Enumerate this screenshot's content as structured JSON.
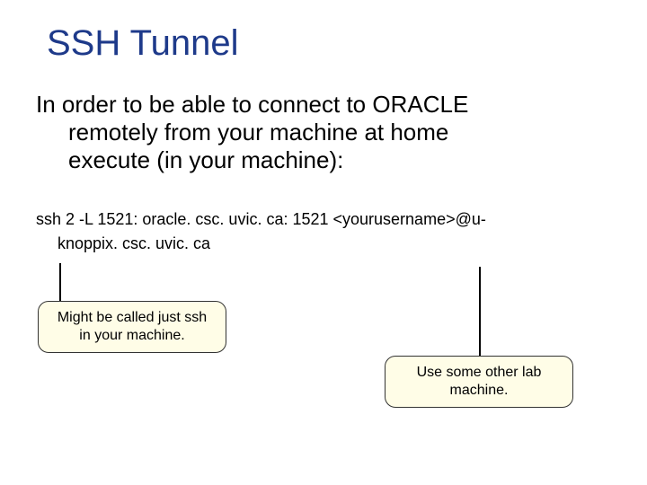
{
  "title": "SSH Tunnel",
  "body": {
    "line1": "In order to be able to connect to ORACLE",
    "line2": "remotely from your machine at home",
    "line3": "execute (in your machine):"
  },
  "command": {
    "part1": "ssh 2 -L 1521: oracle. csc. uvic. ca: 1521 <yourusername>@u-",
    "part2": "knoppix. csc. uvic. ca"
  },
  "callouts": {
    "left": {
      "line1": "Might be called just ssh",
      "line2": "in your machine."
    },
    "right": {
      "line1": "Use some other lab",
      "line2": "machine."
    }
  }
}
